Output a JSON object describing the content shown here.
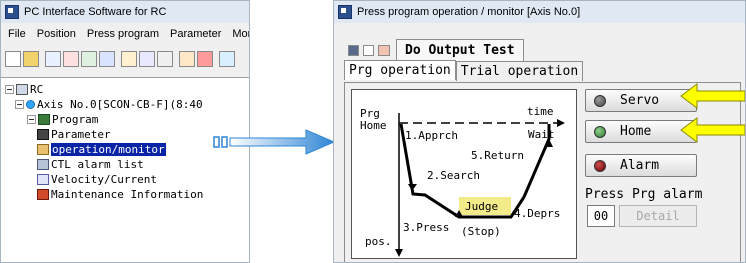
{
  "left_window": {
    "title": "PC Interface Software for RC",
    "menu": [
      "File",
      "Position",
      "Press program",
      "Parameter",
      "Monito"
    ],
    "tree": {
      "root": "RC",
      "axis": "Axis No.0[SCON-CB-F](8:40",
      "children": [
        "Program",
        "Parameter",
        "operation/monitor",
        "CTL alarm list",
        "Velocity/Current",
        "Maintenance Information"
      ]
    }
  },
  "right_window": {
    "title": "Press program operation / monitor [Axis No.0]",
    "toolbar_button": "Do Output Test",
    "tabs": [
      "Prg operation",
      "Trial operation"
    ],
    "diagram": {
      "prg": "Prg",
      "home": "Home",
      "time": "time",
      "wait": "Wait",
      "step1": "1.Apprch",
      "step5": "5.Return",
      "step2": "2.Search",
      "judge": "Judge",
      "step4": "4.Deprs",
      "step3": "3.Press",
      "stop": "(Stop)",
      "pos": "pos."
    },
    "buttons": {
      "servo": "Servo",
      "home": "Home",
      "alarm": "Alarm",
      "detail": "Detail"
    },
    "press_prg_alarm_label": "Press Prg alarm",
    "alarm_value": "00",
    "colors": {
      "servo_led": "#4a4a4a",
      "home_led": "#2f7a2f",
      "alarm_led": "#8b0000",
      "callout_arrow": "#ffff00",
      "pointer_arrow": "#2f86d6"
    }
  }
}
